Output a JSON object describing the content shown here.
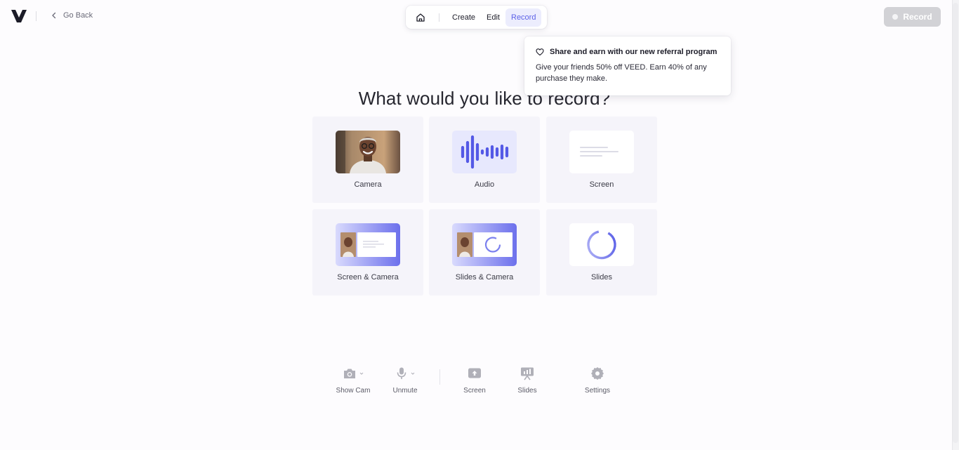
{
  "header": {
    "back_label": "Go Back",
    "nav": {
      "create": "Create",
      "edit": "Edit",
      "record": "Record"
    },
    "record_button": "Record"
  },
  "popup": {
    "title": "Share and earn with our new referral program",
    "body": "Give your friends 50% off VEED. Earn 40% of any purchase they make."
  },
  "headline": "What would you like to record?",
  "options": [
    {
      "label": "Camera",
      "icon": "camera-thumbnail"
    },
    {
      "label": "Audio",
      "icon": "audio-waveform-icon"
    },
    {
      "label": "Screen",
      "icon": "screen-thumbnail"
    },
    {
      "label": "Screen & Camera",
      "icon": "screen-camera-thumbnail"
    },
    {
      "label": "Slides & Camera",
      "icon": "slides-camera-thumbnail"
    },
    {
      "label": "Slides",
      "icon": "slides-thumbnail"
    }
  ],
  "toolbar": {
    "show_cam": "Show Cam",
    "unmute": "Unmute",
    "screen": "Screen",
    "slides": "Slides",
    "settings": "Settings"
  },
  "colors": {
    "accent": "#5d62e8",
    "accent_bg": "#ecedfd",
    "card_bg": "#f5f4fa",
    "record_disabled": "#d2d2d6",
    "icon_gray": "#b0b0b8"
  }
}
